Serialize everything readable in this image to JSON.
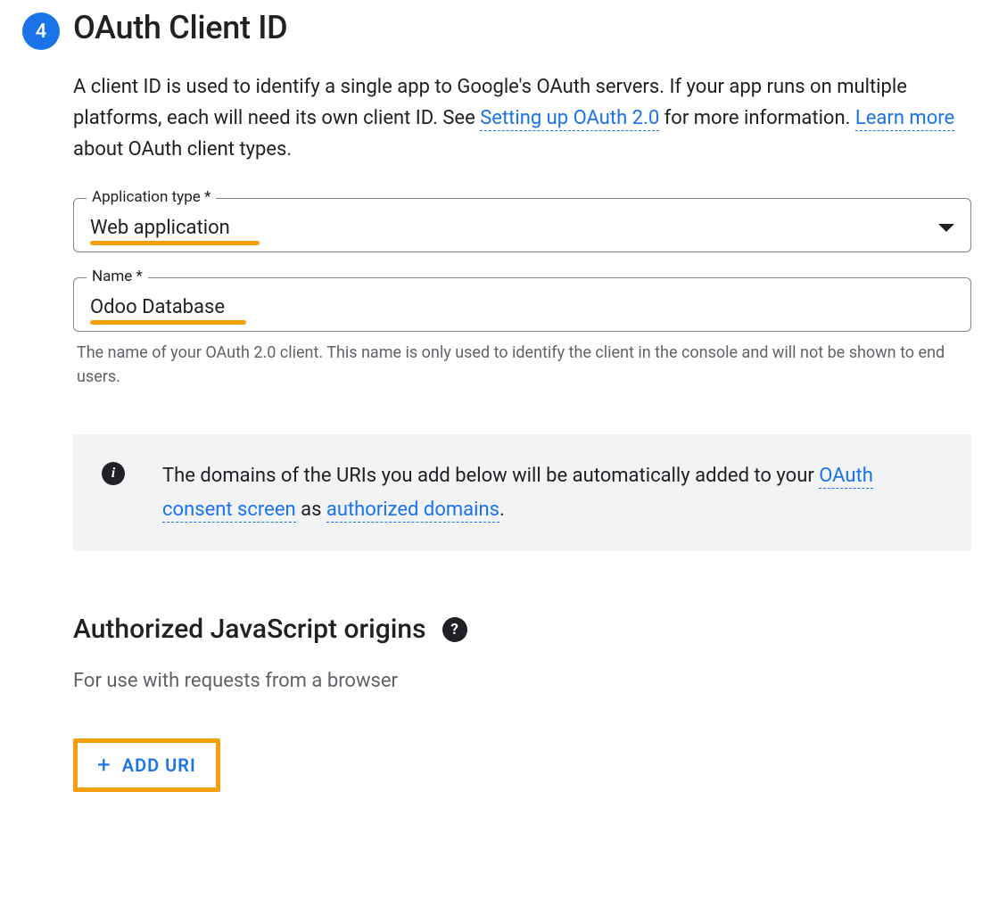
{
  "step": {
    "number": "4",
    "title": "OAuth Client ID"
  },
  "intro": {
    "part1": "A client ID is used to identify a single app to Google's OAuth servers. If your app runs on multiple platforms, each will need its own client ID. See ",
    "link1": "Setting up OAuth 2.0",
    "part2": " for more information. ",
    "link2": "Learn more",
    "part3": " about OAuth client types."
  },
  "appType": {
    "label": "Application type *",
    "value": "Web application"
  },
  "nameField": {
    "label": "Name *",
    "value": "Odoo Database",
    "helper": "The name of your OAuth 2.0 client. This name is only used to identify the client in the console and will not be shown to end users."
  },
  "info": {
    "part1": "The domains of the URIs you add below will be automatically added to your ",
    "link1": "OAuth consent screen",
    "part2": " as ",
    "link2": "authorized domains",
    "part3": "."
  },
  "jsOrigins": {
    "title": "Authorized JavaScript origins",
    "sub": "For use with requests from a browser",
    "addBtn": "ADD URI"
  }
}
